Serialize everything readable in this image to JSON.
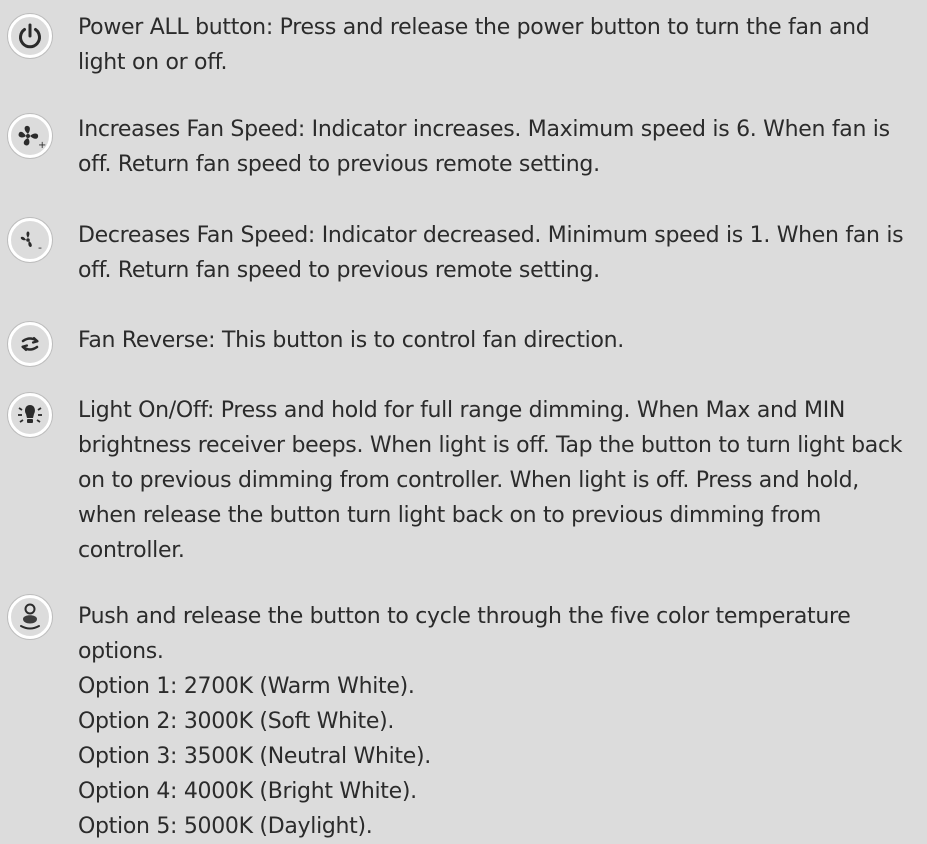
{
  "items": [
    {
      "icon": "power-icon",
      "lines": [
        "Power ALL button: Press and release the power button to turn the fan and",
        "light on or off."
      ]
    },
    {
      "icon": "fan-speed-up-icon",
      "lines": [
        "Increases Fan Speed: Indicator increases. Maximum speed is 6. When fan is",
        "off. Return fan speed to previous remote setting."
      ]
    },
    {
      "icon": "fan-speed-down-icon",
      "lines": [
        "Decreases Fan Speed: Indicator decreased. Minimum speed is 1. When fan is",
        "off. Return fan speed to previous remote setting."
      ]
    },
    {
      "icon": "fan-reverse-icon",
      "lines": [
        "Fan Reverse: This button is to control fan direction."
      ]
    },
    {
      "icon": "light-bulb-icon",
      "lines": [
        "Light On/Off: Press and hold for full range dimming. When Max and MIN",
        "brightness receiver beeps. When light is off. Tap the button to turn light back",
        "on to previous dimming from controller. When light is off. Press and hold,",
        "when release the button turn light back on to previous dimming from",
        "controller."
      ]
    },
    {
      "icon": "color-temperature-icon",
      "lines": [
        "Push and release the button to cycle through the five color temperature",
        "options.",
        "Option 1: 2700K (Warm White).",
        "Option 2: 3000K (Soft White).",
        "Option 3: 3500K (Neutral White).",
        "Option 4: 4000K (Bright White).",
        "Option 5: 5000K (Daylight)."
      ]
    }
  ]
}
